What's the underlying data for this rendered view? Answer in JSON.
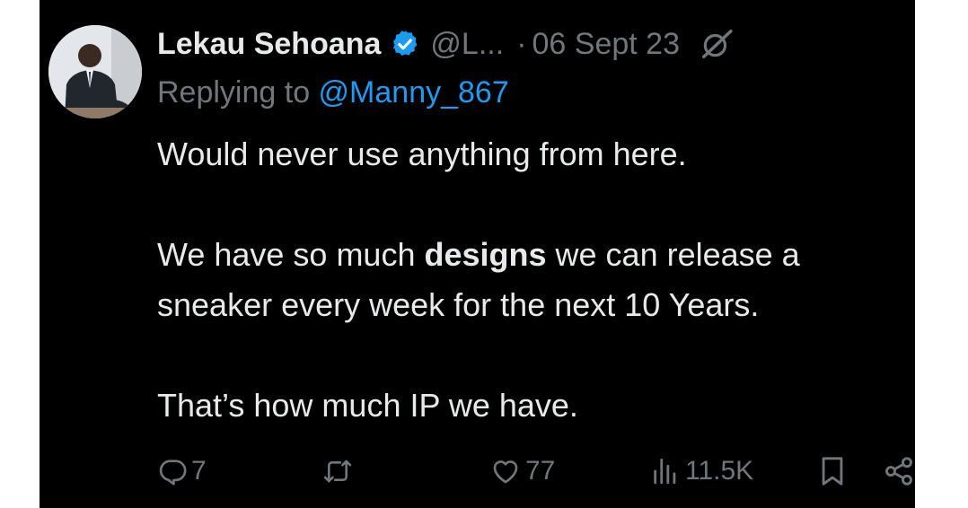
{
  "tweet": {
    "author_name": "Lekau Sehoana",
    "handle": "@L...",
    "separator": "·",
    "date": "06 Sept 23",
    "replying_prefix": "Replying to ",
    "replying_handle": "@Manny_867",
    "line1": "Would never use anything from here.",
    "line2_pre": "We have so much ",
    "line2_bold": "designs",
    "line2_post": " we can release a sneaker every week for the next 10 Years.",
    "line3": "That’s how much IP we have."
  },
  "actions": {
    "reply_count": "7",
    "retweet_count": "",
    "like_count": "77",
    "views_count": "11.5K"
  },
  "colors": {
    "background": "#000000",
    "text": "#e7e9ea",
    "muted": "#71767b",
    "accent": "#1d9bf0"
  },
  "icons": [
    "verified-badge-icon",
    "grok-icon",
    "reply-icon",
    "retweet-icon",
    "like-icon",
    "views-icon",
    "bookmark-icon",
    "share-icon"
  ]
}
